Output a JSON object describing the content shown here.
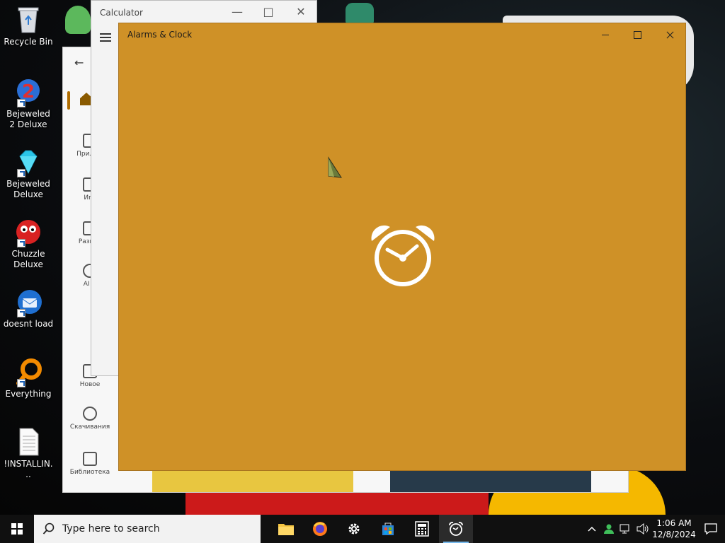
{
  "desktop_icons": [
    {
      "label": "Recycle Bin"
    },
    {
      "label": "Bejeweled 2 Deluxe"
    },
    {
      "label": "Bejeweled Deluxe"
    },
    {
      "label": "Chuzzle Deluxe"
    },
    {
      "label": "doesnt load"
    },
    {
      "label": "Everything"
    },
    {
      "label": "!INSTALLIN..."
    }
  ],
  "calculator": {
    "title": "Calculator"
  },
  "store": {
    "nav": [
      {
        "label": "Прилож"
      },
      {
        "label": "Игр"
      },
      {
        "label": "Развле"
      },
      {
        "label": "AI Н"
      },
      {
        "label": "Новое"
      },
      {
        "label": "Скачивания"
      },
      {
        "label": "Библиотека"
      }
    ]
  },
  "alarms": {
    "title": "Alarms & Clock",
    "background": "#cf9127"
  },
  "taskbar": {
    "search_placeholder": "Type here to search",
    "apps": [
      {
        "icon": "file-explorer-icon"
      },
      {
        "icon": "firefox-icon"
      },
      {
        "icon": "settings-icon"
      },
      {
        "icon": "microsoft-store-icon"
      },
      {
        "icon": "calculator-icon"
      },
      {
        "icon": "alarms-clock-icon",
        "active": true
      }
    ],
    "time": "1:06 AM",
    "date": "12/8/2024"
  }
}
